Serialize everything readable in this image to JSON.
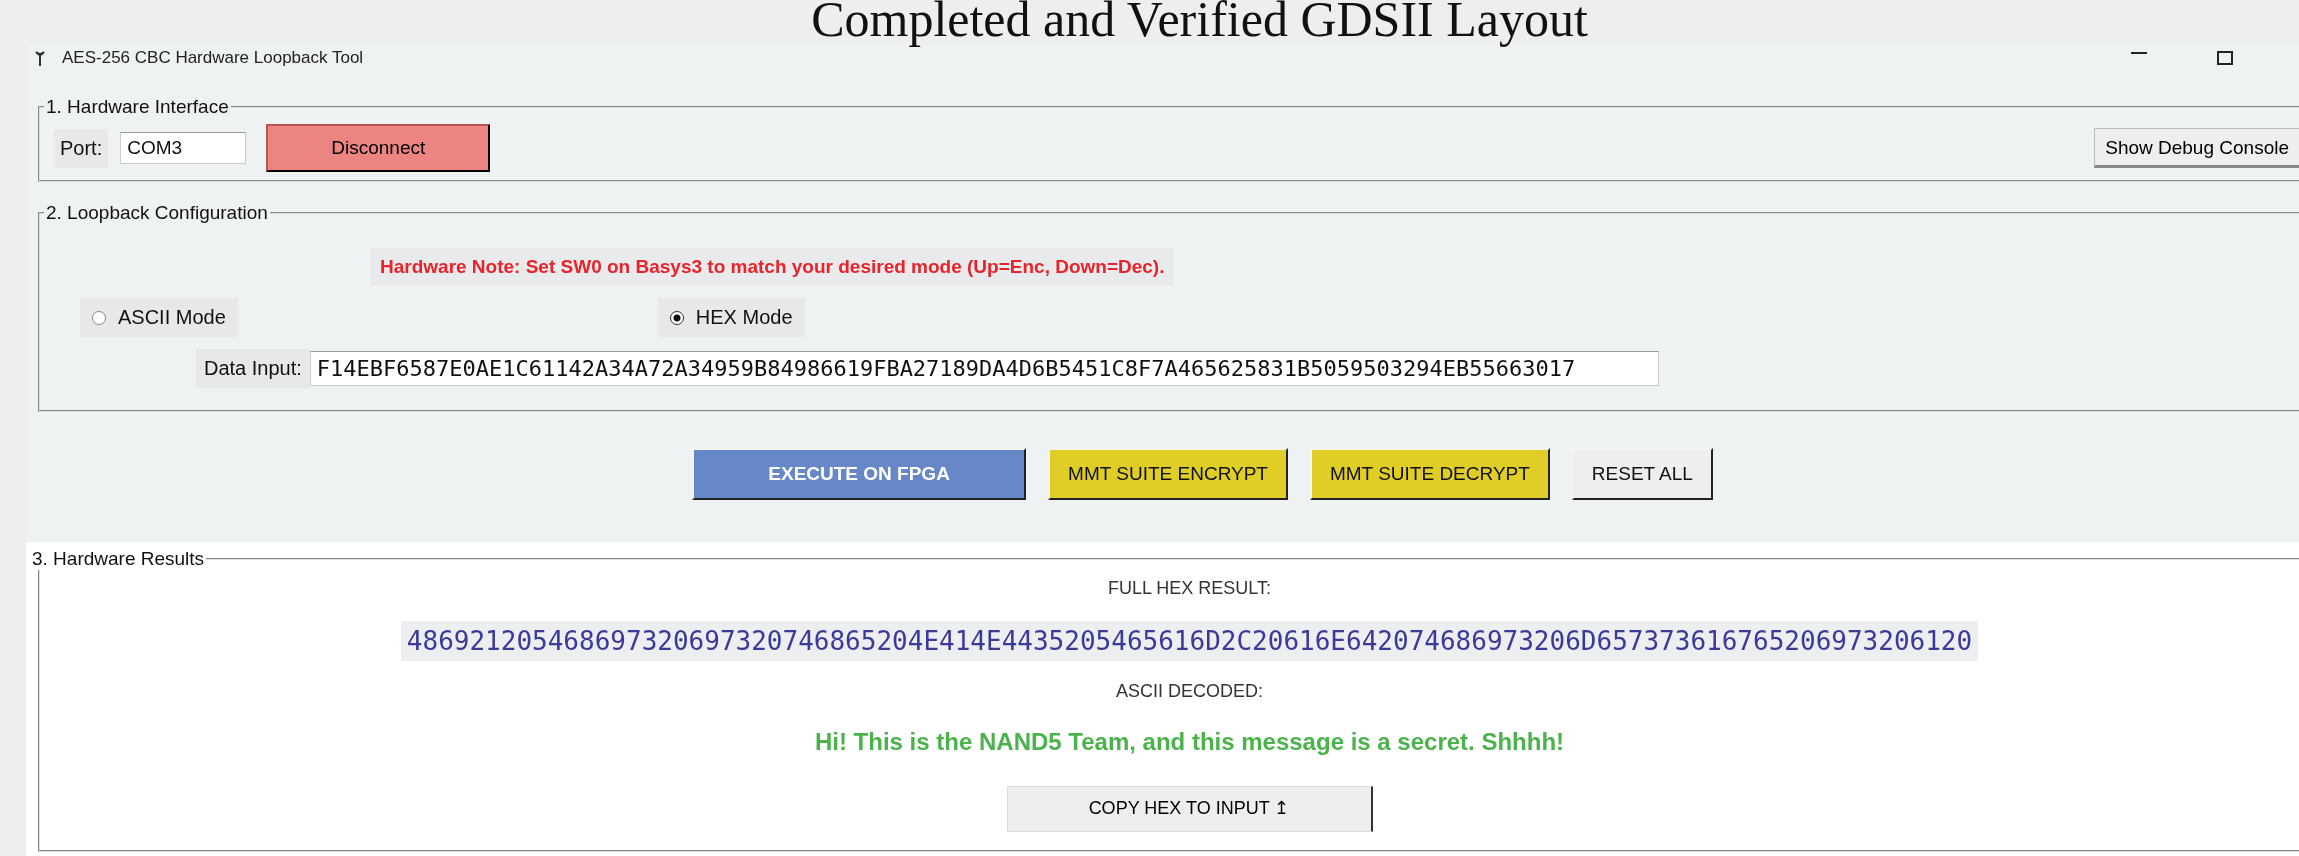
{
  "caption": "Completed and Verified GDSII Layout",
  "window": {
    "title": "AES-256 CBC Hardware Loopback Tool"
  },
  "hardware": {
    "legend": "1. Hardware Interface",
    "port_label": "Port:",
    "port_value": "COM3",
    "connect_button": "Disconnect",
    "debug_button": "Show Debug Console"
  },
  "config": {
    "legend": "2. Loopback Configuration",
    "note": "Hardware Note: Set SW0 on Basys3 to match your desired mode (Up=Enc, Down=Dec).",
    "modes": [
      {
        "label": "ASCII Mode",
        "selected": false
      },
      {
        "label": "HEX Mode",
        "selected": true
      }
    ],
    "data_label": "Data Input:",
    "data_value": "F14EBF6587E0AE1C61142A34A72A34959B84986619FBA27189DA4D6B5451C8F7A465625831B5059503294EB55663017"
  },
  "actions": [
    {
      "label": "EXECUTE ON FPGA",
      "kind": "primary"
    },
    {
      "label": "MMT SUITE ENCRYPT",
      "kind": "suite"
    },
    {
      "label": "MMT SUITE DECRYPT",
      "kind": "suite"
    },
    {
      "label": "RESET ALL",
      "kind": "plain"
    }
  ],
  "results": {
    "legend": "3. Hardware Results",
    "hex_label": "FULL HEX RESULT:",
    "hex_value": "486921205468697320697320746865204E414E4435205465616D2C20616E642074686973206D657373616765206973206120",
    "ascii_label": "ASCII DECODED:",
    "ascii_value": "Hi! This is the NAND5 Team, and this message is a secret. Shhhh!",
    "copy_button": "COPY HEX TO INPUT ↥"
  }
}
